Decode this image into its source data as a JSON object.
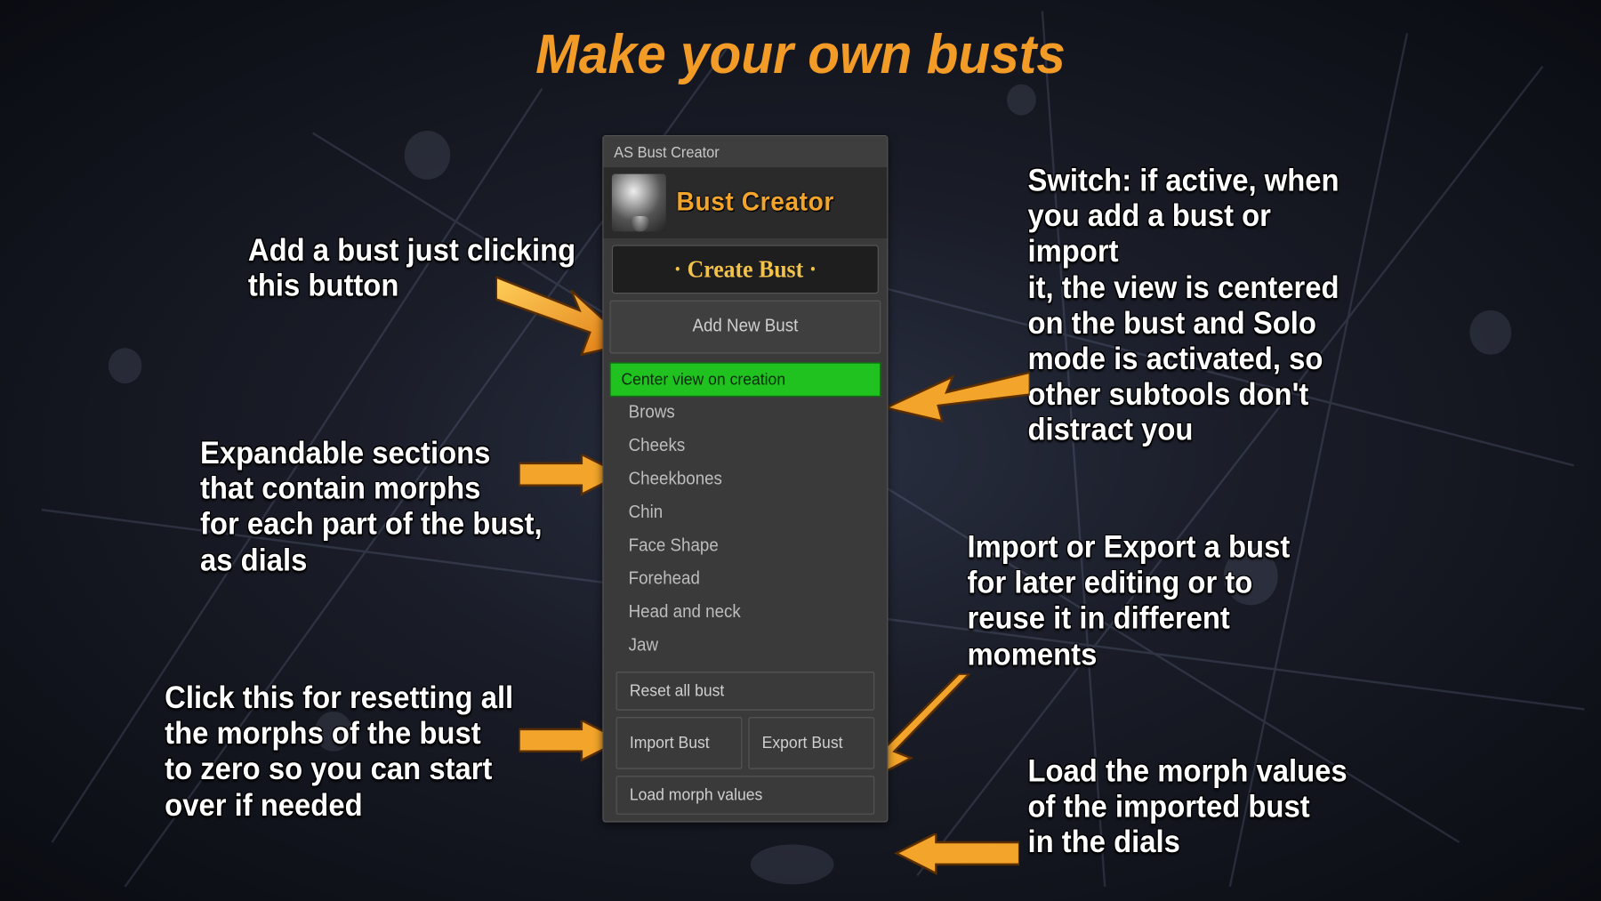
{
  "title": "Make your own busts",
  "panel": {
    "window_title": "AS Bust Creator",
    "logo_text": "Bust Creator",
    "create_bar": "· Create Bust ·",
    "add_button": "Add New Bust",
    "center_toggle": "Center view on creation",
    "sections": [
      "Brows",
      "Cheeks",
      "Cheekbones",
      "Chin",
      "Face Shape",
      "Forehead",
      "Head and neck",
      "Jaw"
    ],
    "reset_button": "Reset all bust",
    "import_button": "Import Bust",
    "export_button": "Export Bust",
    "load_button": "Load morph values"
  },
  "annotations": {
    "add": "Add a bust just clicking\nthis button",
    "sections": "Expandable sections\nthat contain morphs\nfor each part of the bust,\nas dials",
    "reset": "Click this for resetting all\nthe morphs of the bust\nto zero so you can start\nover if needed",
    "switch": "Switch: if active, when\nyou add a bust or import\nit, the view is centered\non the bust and Solo\nmode is activated, so\nother subtools don't \ndistract you",
    "import_export": "Import or Export a bust\nfor later editing or to\nreuse it in different\nmoments",
    "load": "Load the morph values\nof the imported bust\nin the dials"
  }
}
